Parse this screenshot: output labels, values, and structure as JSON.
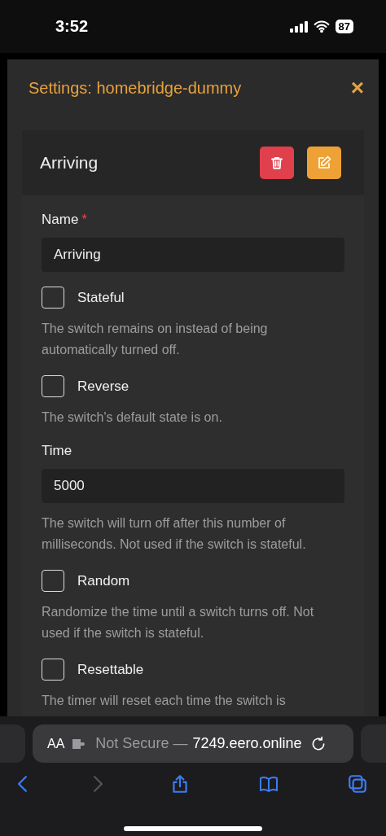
{
  "status_bar": {
    "time": "3:52",
    "battery": "87"
  },
  "modal": {
    "title": "Settings: homebridge-dummy",
    "close": "×"
  },
  "card": {
    "title": "Arriving",
    "fields": [
      {
        "kind": "text",
        "label": "Name",
        "required_mark": "*",
        "value": "Arriving"
      },
      {
        "kind": "checkbox",
        "label": "Stateful",
        "checked": false,
        "description": "The switch remains on instead of being automatically turned off."
      },
      {
        "kind": "checkbox",
        "label": "Reverse",
        "checked": false,
        "description": "The switch's default state is on."
      },
      {
        "kind": "text",
        "label": "Time",
        "value": "5000",
        "description": "The switch will turn off after this number of milliseconds. Not used if the switch is stateful."
      },
      {
        "kind": "checkbox",
        "label": "Random",
        "checked": false,
        "description": "Randomize the time until a switch turns off. Not used if the switch is stateful."
      },
      {
        "kind": "checkbox",
        "label": "Resettable",
        "checked": false,
        "description": "The timer will reset each time the switch is"
      }
    ]
  },
  "browser": {
    "text_size": "AA",
    "security": "Not Secure —",
    "url": "7249.eero.online"
  }
}
